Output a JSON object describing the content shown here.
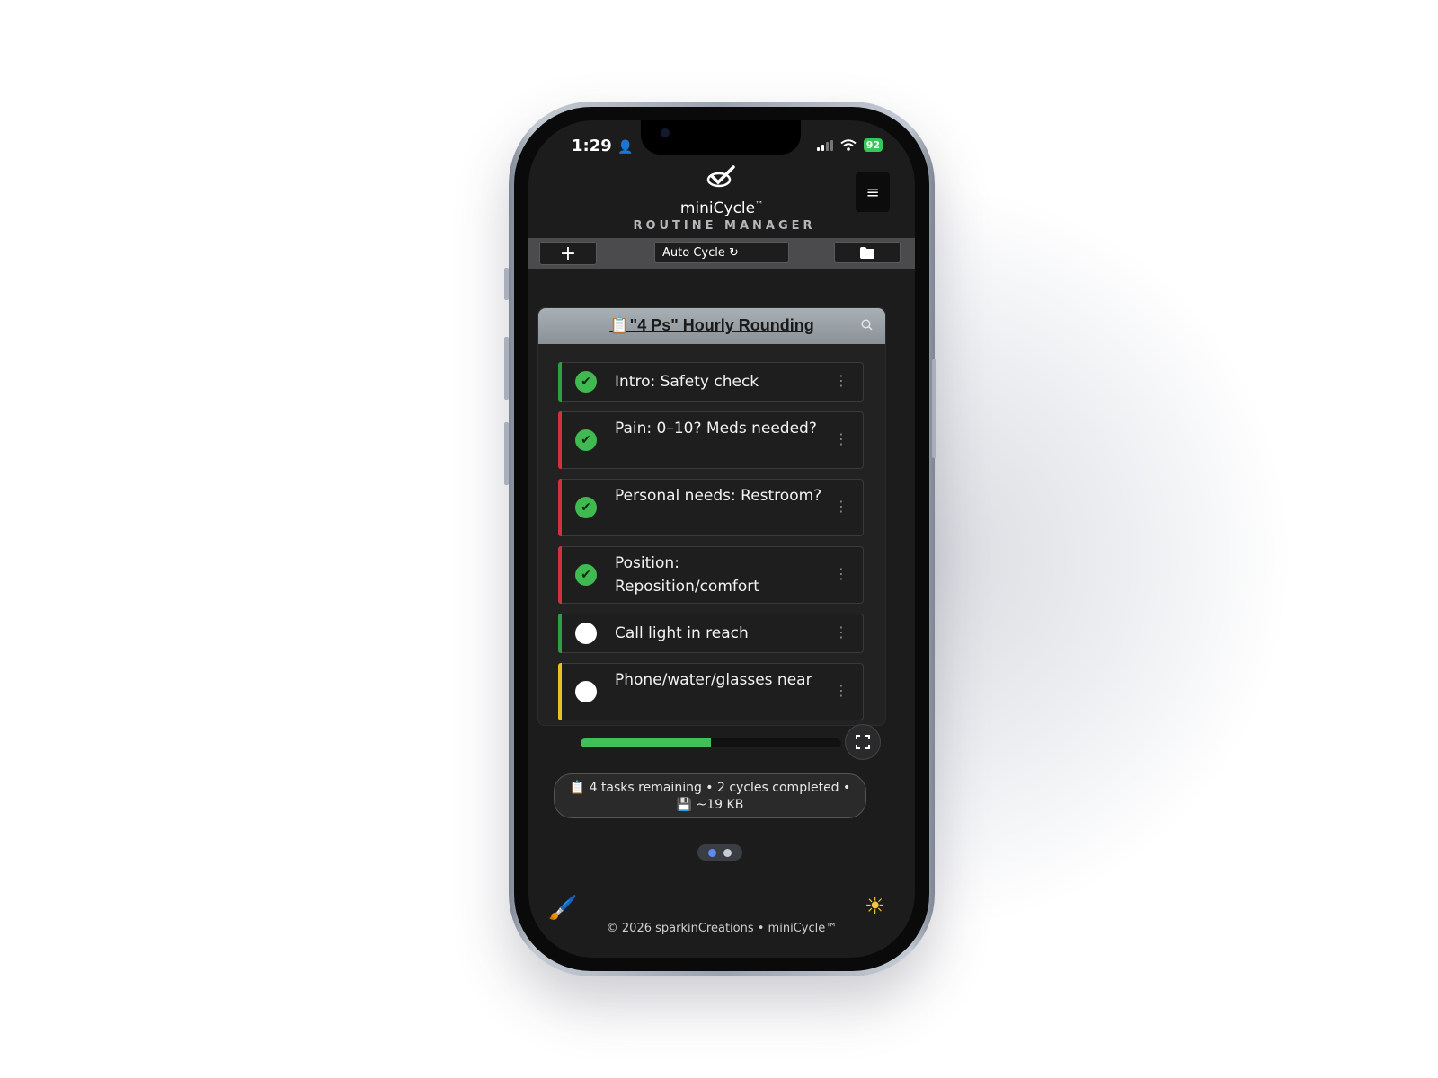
{
  "status_bar": {
    "time": "1:29",
    "battery": "92"
  },
  "app": {
    "name": "miniCycle",
    "trademark": "™",
    "subtitle": "ROUTINE MANAGER"
  },
  "menu": {
    "icon": "≡"
  },
  "toolbar": {
    "add_label": "+",
    "auto_cycle_label": "Auto Cycle ↻",
    "folder_icon": "folder-icon"
  },
  "list": {
    "title": "📋\"4 Ps\" Hourly Rounding",
    "tasks": [
      {
        "label": "Intro: Safety check",
        "done": true,
        "color": "#2ea043"
      },
      {
        "label": "Pain: 0–10? Meds needed?",
        "done": true,
        "color": "#d0323e"
      },
      {
        "label": "Personal needs: Restroom?",
        "done": true,
        "color": "#d0323e"
      },
      {
        "label": "Position: Reposition/comfort",
        "done": true,
        "color": "#d0323e"
      },
      {
        "label": "Call light in reach",
        "done": false,
        "color": "#2ea043"
      },
      {
        "label": "Phone/water/glasses near",
        "done": false,
        "color": "#e6c229"
      }
    ]
  },
  "progress": {
    "fraction": 0.5
  },
  "stats": {
    "line1": "📋 4 tasks remaining • 2 cycles completed •",
    "line2": "💾 ~19 KB"
  },
  "pager": {
    "active_color": "#5b8def",
    "inactive_color": "#c8ccd4"
  },
  "footer": {
    "text": "© 2026 sparkinCreations • miniCycle™"
  },
  "icons": {
    "brush": "🖌️",
    "theme": "☀"
  }
}
